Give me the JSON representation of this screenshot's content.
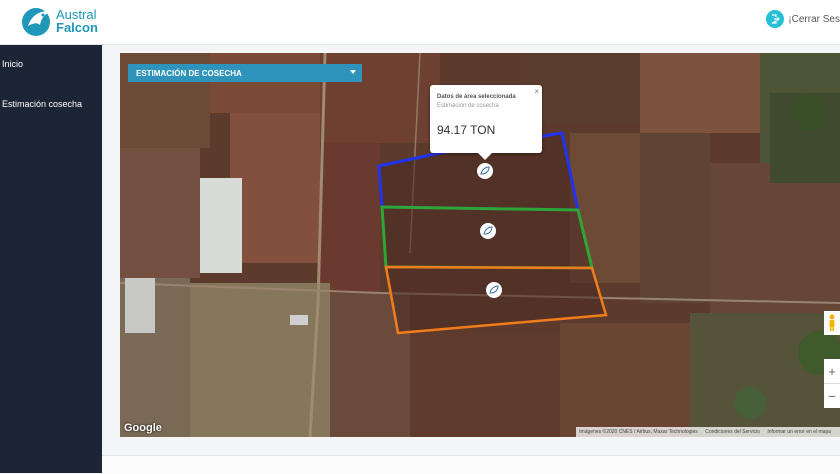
{
  "brand": {
    "line1": "Austral",
    "line2": "Falcon"
  },
  "header": {
    "logout_label": "¡Cerrar Ses"
  },
  "sidebar": {
    "items": [
      {
        "label": "Inicio"
      },
      {
        "label": "Estimación cosecha"
      }
    ]
  },
  "map": {
    "dropdown_label": "ESTIMACIÓN DE COSECHA",
    "popup": {
      "title": "Datos de área seleccionada",
      "subtitle": "Estimación de cosecha",
      "value": "94.17 TON",
      "close": "×"
    },
    "google_label": "Google",
    "attribution": {
      "imagery": "Imágenes ©2020 CNES / Airbus, Maxar Technologies",
      "terms": "Condiciones del Servicio",
      "report": "Informar un error en el mapa"
    },
    "zoom_in": "+",
    "zoom_out": "−",
    "polygons": [
      {
        "name": "blue-field",
        "color": "#2233ee"
      },
      {
        "name": "green-field",
        "color": "#2fa535"
      },
      {
        "name": "orange-field",
        "color": "#f07c1c"
      }
    ]
  }
}
